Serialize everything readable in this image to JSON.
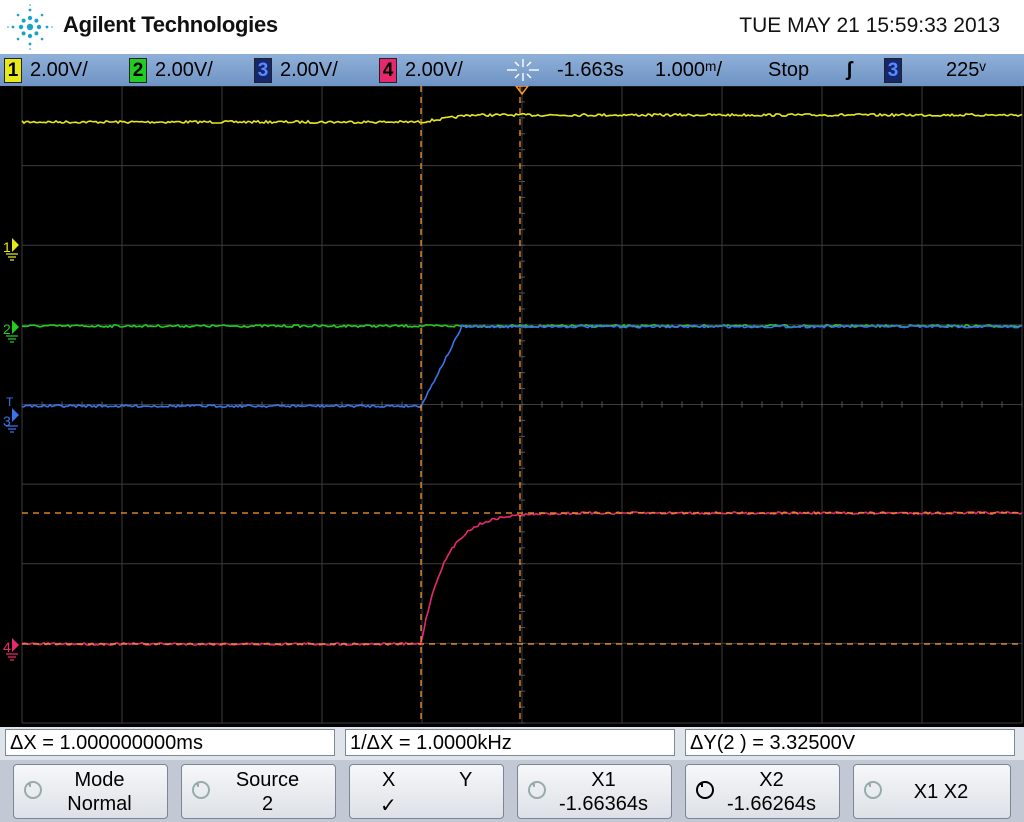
{
  "header": {
    "brand": "Agilent Technologies",
    "datetime": "TUE MAY 21 15:59:33 2013"
  },
  "status": {
    "channels": [
      {
        "num": "1",
        "scale": "2.00V/",
        "color": "#e8e81a"
      },
      {
        "num": "2",
        "scale": "2.00V/",
        "color": "#22cc22"
      },
      {
        "num": "3",
        "scale": "2.00V/",
        "color": "#3a74e8"
      },
      {
        "num": "4",
        "scale": "2.00V/",
        "color": "#e8286e"
      }
    ],
    "delay": "-1.663s",
    "timebase": "1.000ᵐ/",
    "run_state": "Stop",
    "trigger_slope": "ʃ",
    "trigger_source": "3",
    "trigger_level": "225ᵛ"
  },
  "markers": {
    "ch1": "1",
    "ch2": "2",
    "ch3": "3",
    "ch3_trigger": "T",
    "ch4": "4"
  },
  "measurements": {
    "delta_x": "ΔX = 1.000000000ms",
    "inv_delta_x": "1/ΔX = 1.0000kHz",
    "delta_y": "ΔY(2 ) = 3.32500V"
  },
  "softkeys": {
    "mode": {
      "line1": "Mode",
      "line2": "Normal"
    },
    "source": {
      "line1": "Source",
      "line2": "2"
    },
    "xy": {
      "x": "X",
      "y": "Y",
      "check": "✓"
    },
    "x1": {
      "line1": "X1",
      "line2": "-1.66364s"
    },
    "x2": {
      "line1": "X2",
      "line2": "-1.66264s"
    },
    "x1x2": {
      "label": "X1 X2"
    }
  },
  "colors": {
    "ch1": "#e8e81a",
    "ch2": "#22cc22",
    "ch3": "#3a74e8",
    "ch4": "#e8286e",
    "cursor": "#ff9a2a",
    "grid": "#3c3c3c"
  }
}
